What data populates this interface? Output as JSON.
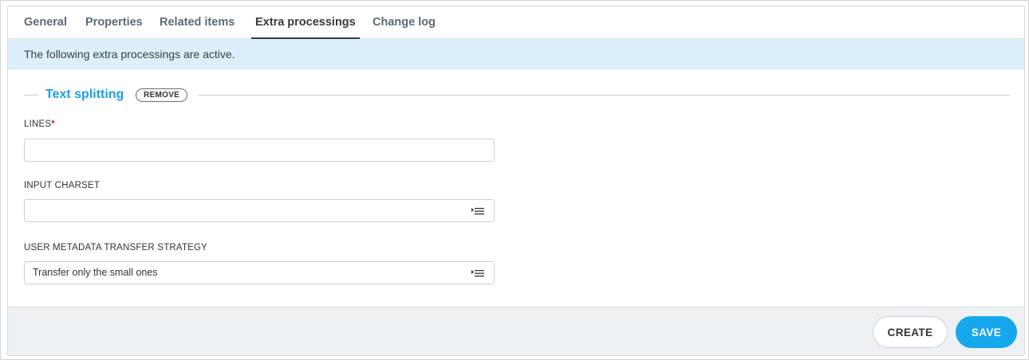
{
  "tabs": [
    {
      "label": "General"
    },
    {
      "label": "Properties"
    },
    {
      "label": "Related items"
    },
    {
      "label": "Extra processings",
      "active": true
    },
    {
      "label": "Change log"
    }
  ],
  "banner": {
    "text": "The following extra processings are active."
  },
  "section": {
    "title": "Text splitting",
    "remove_label": "REMOVE"
  },
  "fields": {
    "lines": {
      "label": "LINES",
      "required_mark": "*",
      "value": ""
    },
    "input_charset": {
      "label": "INPUT CHARSET",
      "value": ""
    },
    "metadata_strategy": {
      "label": "USER METADATA TRANSFER STRATEGY",
      "value": "Transfer only the small ones"
    }
  },
  "footer": {
    "create_label": "CREATE",
    "save_label": "SAVE"
  },
  "colors": {
    "accent": "#1ba1e2",
    "save_button": "#16a8ec",
    "banner_bg": "#dcf0fb",
    "footer_bg": "#eef1f4",
    "required": "#c0392b"
  },
  "icons": {
    "select": "select-list-icon"
  }
}
